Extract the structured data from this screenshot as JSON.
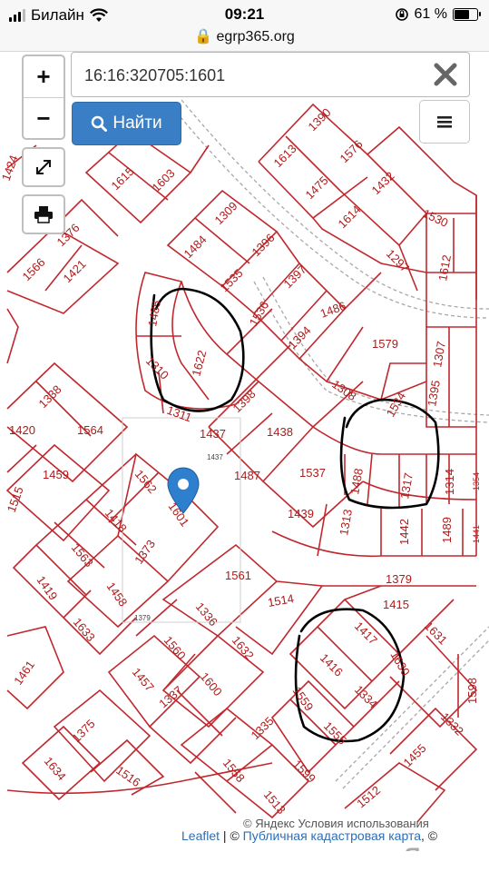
{
  "status_bar": {
    "carrier": "Билайн",
    "time": "09:21",
    "battery": "61 %"
  },
  "browser": {
    "url": "egrp365.org"
  },
  "search": {
    "value": "16:16:320705:1601",
    "button_label": "Найти"
  },
  "controls": {
    "zoom_in": "+",
    "zoom_out": "−"
  },
  "map": {
    "highlight_plot": "1601",
    "plots": [
      "1390",
      "1613",
      "1576",
      "1475",
      "1432",
      "1615",
      "1603",
      "1614",
      "1530",
      "1424",
      "1309",
      "1484",
      "1396",
      "1297",
      "1376",
      "1535",
      "1612",
      "1566",
      "1421",
      "1397",
      "1486",
      "1536",
      "1485",
      "1579",
      "1307",
      "1394",
      "1622",
      "1310",
      "1398",
      "1308",
      "1534",
      "1395",
      "1311",
      "1338",
      "1437",
      "1438",
      "1420",
      "1564",
      "1459",
      "1562",
      "1487",
      "1537",
      "1488",
      "1317",
      "1314",
      "1354",
      "1515",
      "1601",
      "1418",
      "1439",
      "1313",
      "1442",
      "1489",
      "1441",
      "1373",
      "1563",
      "1379",
      "1561",
      "1419",
      "1458",
      "1415",
      "1514",
      "1336",
      "1417",
      "1631",
      "1633",
      "1560",
      "1632",
      "1416",
      "1630",
      "1598",
      "1461",
      "1457",
      "1600",
      "1559",
      "1334",
      "1337",
      "1332",
      "1375",
      "1335",
      "1558",
      "1455",
      "1634",
      "1516",
      "1599",
      "1513",
      "1512"
    ],
    "attribution": {
      "leaflet": "Leaflet",
      "sep": " | © ",
      "cadastre": "Публичная кадастровая карта",
      "tail": ", ©",
      "yandex_terms": "© Яндекс  Условия использования",
      "yandex_logo": "Яндекс"
    }
  },
  "colors": {
    "parcel": "#c0282e",
    "button": "#3a7fc6",
    "marker": "#2e7fce",
    "road": "#9a9a9a"
  }
}
